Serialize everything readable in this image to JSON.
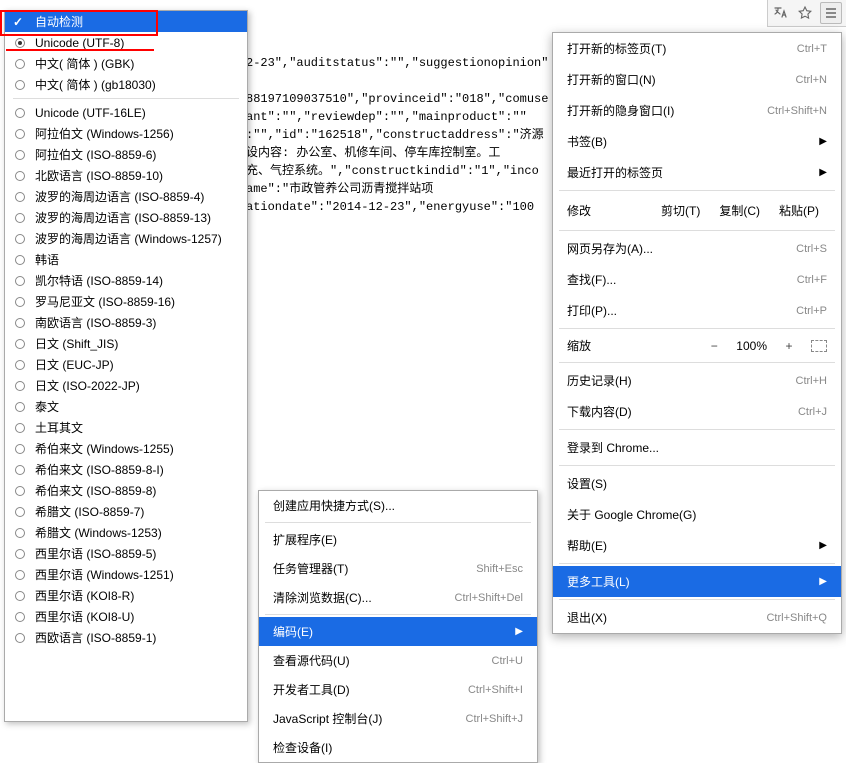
{
  "json_text": "2-23\",\"auditstatus\":\"\",\"suggestionopinion\"\n\n88197109037510\",\"provinceid\":\"018\",\"comuse\nant\":\"\",\"reviewdep\":\"\",\"mainproduct\":\"\"\n:\"\",\"id\":\"162518\",\"constructaddress\":\"济源\n设内容: 办公室、机修车间、停车库控制室。工\n充、气控系统。\",\"constructkindid\":\"1\",\"inco\name\":\"市政管养公司沥青搅拌站项\nationdate\":\"2014-12-23\",\"energyuse\":\"100",
  "encoding": {
    "auto": "自动检测",
    "items": [
      "Unicode (UTF-8)",
      "中文( 简体 ) (GBK)",
      "中文( 简体 ) (gb18030)",
      "Unicode (UTF-16LE)",
      "阿拉伯文 (Windows-1256)",
      "阿拉伯文 (ISO-8859-6)",
      "北欧语言 (ISO-8859-10)",
      "波罗的海周边语言 (ISO-8859-4)",
      "波罗的海周边语言 (ISO-8859-13)",
      "波罗的海周边语言 (Windows-1257)",
      "韩语",
      "凯尔特语 (ISO-8859-14)",
      "罗马尼亚文 (ISO-8859-16)",
      "南欧语言 (ISO-8859-3)",
      "日文 (Shift_JIS)",
      "日文 (EUC-JP)",
      "日文 (ISO-2022-JP)",
      "泰文",
      "土耳其文",
      "希伯来文 (Windows-1255)",
      "希伯来文 (ISO-8859-8-I)",
      "希伯来文 (ISO-8859-8)",
      "希腊文 (ISO-8859-7)",
      "希腊文 (Windows-1253)",
      "西里尔语 (ISO-8859-5)",
      "西里尔语 (Windows-1251)",
      "西里尔语 (KOI8-R)",
      "西里尔语 (KOI8-U)",
      "西欧语言 (ISO-8859-1)"
    ]
  },
  "submenu": {
    "create_shortcut": "创建应用快捷方式(S)...",
    "extensions": "扩展程序(E)",
    "task_manager": "任务管理器(T)",
    "task_manager_short": "Shift+Esc",
    "clear_data": "清除浏览数据(C)...",
    "clear_data_short": "Ctrl+Shift+Del",
    "encoding": "编码(E)",
    "view_source": "查看源代码(U)",
    "view_source_short": "Ctrl+U",
    "dev_tools": "开发者工具(D)",
    "dev_tools_short": "Ctrl+Shift+I",
    "js_console": "JavaScript 控制台(J)",
    "js_console_short": "Ctrl+Shift+J",
    "inspect": "检查设备(I)"
  },
  "mainmenu": {
    "new_tab": "打开新的标签页(T)",
    "new_tab_short": "Ctrl+T",
    "new_window": "打开新的窗口(N)",
    "new_window_short": "Ctrl+N",
    "incognito": "打开新的隐身窗口(I)",
    "incognito_short": "Ctrl+Shift+N",
    "bookmarks": "书签(B)",
    "recent_tabs": "最近打开的标签页",
    "edit": "修改",
    "cut": "剪切(T)",
    "copy": "复制(C)",
    "paste": "粘贴(P)",
    "save_as": "网页另存为(A)...",
    "save_as_short": "Ctrl+S",
    "find": "查找(F)...",
    "find_short": "Ctrl+F",
    "print": "打印(P)...",
    "print_short": "Ctrl+P",
    "zoom": "缩放",
    "zoom_val": "100%",
    "history": "历史记录(H)",
    "history_short": "Ctrl+H",
    "downloads": "下载内容(D)",
    "downloads_short": "Ctrl+J",
    "signin": "登录到 Chrome...",
    "settings": "设置(S)",
    "about": "关于 Google Chrome(G)",
    "help": "帮助(E)",
    "more_tools": "更多工具(L)",
    "quit": "退出(X)",
    "quit_short": "Ctrl+Shift+Q"
  }
}
